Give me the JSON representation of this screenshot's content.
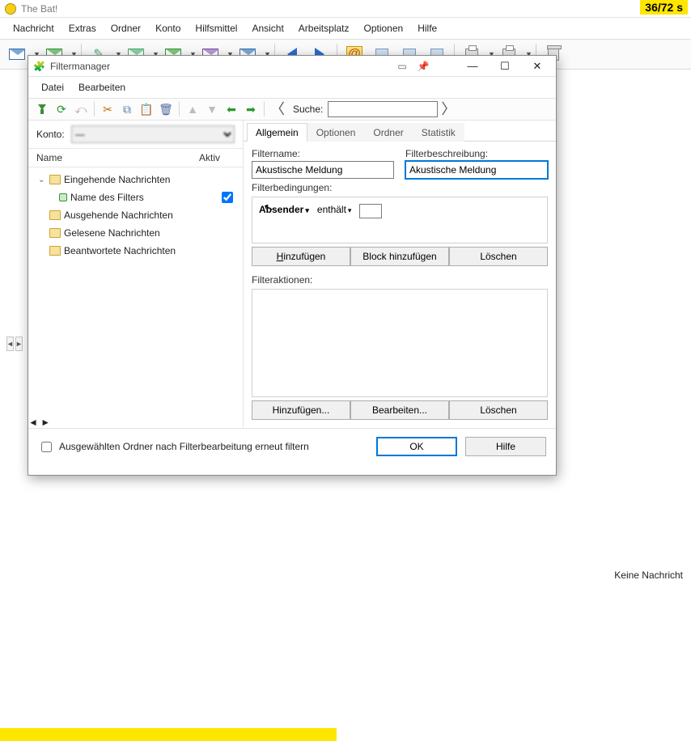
{
  "app": {
    "title": "The Bat!",
    "timer": "36/72 s",
    "no_mail": "Keine Nachricht"
  },
  "menu": {
    "items": [
      "Nachricht",
      "Extras",
      "Ordner",
      "Konto",
      "Hilfsmittel",
      "Ansicht",
      "Arbeitsplatz",
      "Optionen",
      "Hilfe"
    ]
  },
  "dialog": {
    "title": "Filtermanager",
    "menu": [
      "Datei",
      "Bearbeiten"
    ],
    "search_label": "Suche:",
    "search_value": "",
    "account_label": "Konto:",
    "account_value": "—",
    "list_head": {
      "c1": "Name",
      "c2": "Aktiv"
    },
    "tree": {
      "root": "Eingehende Nachrichten",
      "child": "Name des Filters",
      "others": [
        "Ausgehende Nachrichten",
        "Gelesene Nachrichten",
        "Beantwortete Nachrichten"
      ]
    },
    "tabs": [
      "Allgemein",
      "Optionen",
      "Ordner",
      "Statistik"
    ],
    "labels": {
      "filtername": "Filtername:",
      "filterdesc": "Filterbeschreibung:",
      "conditions": "Filterbedingungen:",
      "actions": "Filteraktionen:"
    },
    "values": {
      "filtername": "Akustische Meldung",
      "filterdesc": "Akustische Meldung",
      "cond_field": "Absender",
      "cond_op": "enthält",
      "cond_value": ""
    },
    "buttons": {
      "add": "Hinzufügen",
      "add_block": "Block hinzufügen",
      "delete": "Löschen",
      "add2": "Hinzufügen...",
      "edit": "Bearbeiten...",
      "delete2": "Löschen",
      "ok": "OK",
      "help": "Hilfe"
    },
    "footer_check": "Ausgewählten Ordner nach Filterbearbeitung erneut filtern"
  }
}
